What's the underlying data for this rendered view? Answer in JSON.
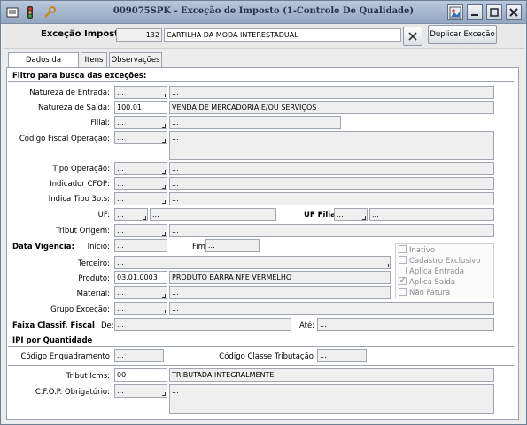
{
  "window": {
    "title": "009075SPK - Exceção de Imposto (1-Controle De Qualidade)"
  },
  "header": {
    "label": "Exceção Imposto",
    "code": "132",
    "description": "CARTILHA DA MODA INTERESTADUAL",
    "duplicate_label": "Duplicar Exceção"
  },
  "tabs": [
    "Dados da Exceção",
    "Itens",
    "Observações"
  ],
  "sections": {
    "filtro": "Filtro para busca das exceções:",
    "vigencia": "Data Vigência:",
    "faixa": "Faixa Classif. Fiscal",
    "ipi": "IPI por Quantidade"
  },
  "labels": {
    "natureza_entrada": "Natureza de Entrada:",
    "natureza_saida": "Natureza de Saída:",
    "filial": "Filial:",
    "cfop": "Código Fiscal Operação:",
    "tipo_operacao": "Tipo Operação:",
    "indicador_cfop": "Indicador CFOP:",
    "indica_tipo": "Indica Tipo 3o.s:",
    "uf": "UF:",
    "uf_filial": "UF Filial",
    "tribut_origem": "Tribut Origem:",
    "inicio": "Início:",
    "fim": "Fim",
    "terceiro": "Terceiro:",
    "produto": "Produto:",
    "material": "Material:",
    "grupo_excecao": "Grupo Exceção:",
    "de": "De:",
    "ate": "Até:",
    "codigo_enquadramento": "Código Enquadramento",
    "codigo_classe": "Código Classe Tributação",
    "tribut_icms": "Tribut Icms:",
    "cfop_obrigatorio": "C.F.O.P. Obrigatório:"
  },
  "values": {
    "empty": "...",
    "natureza_saida_code": "100.01",
    "natureza_saida_desc": "VENDA DE MERCADORIA E/OU SERVIÇOS",
    "produto_code": "03.01.0003",
    "produto_desc": "PRODUTO BARRA NFE VERMELHO",
    "tribut_icms_code": "00",
    "tribut_icms_desc": "TRIBUTADA INTEGRALMENTE"
  },
  "checkboxes": [
    {
      "label": "Inativo",
      "checked": false
    },
    {
      "label": "Cadastro Exclusivo",
      "checked": false
    },
    {
      "label": "Aplica Entrada",
      "checked": false
    },
    {
      "label": "Aplica Saída",
      "checked": true
    },
    {
      "label": "Não Fatura",
      "checked": false
    }
  ]
}
